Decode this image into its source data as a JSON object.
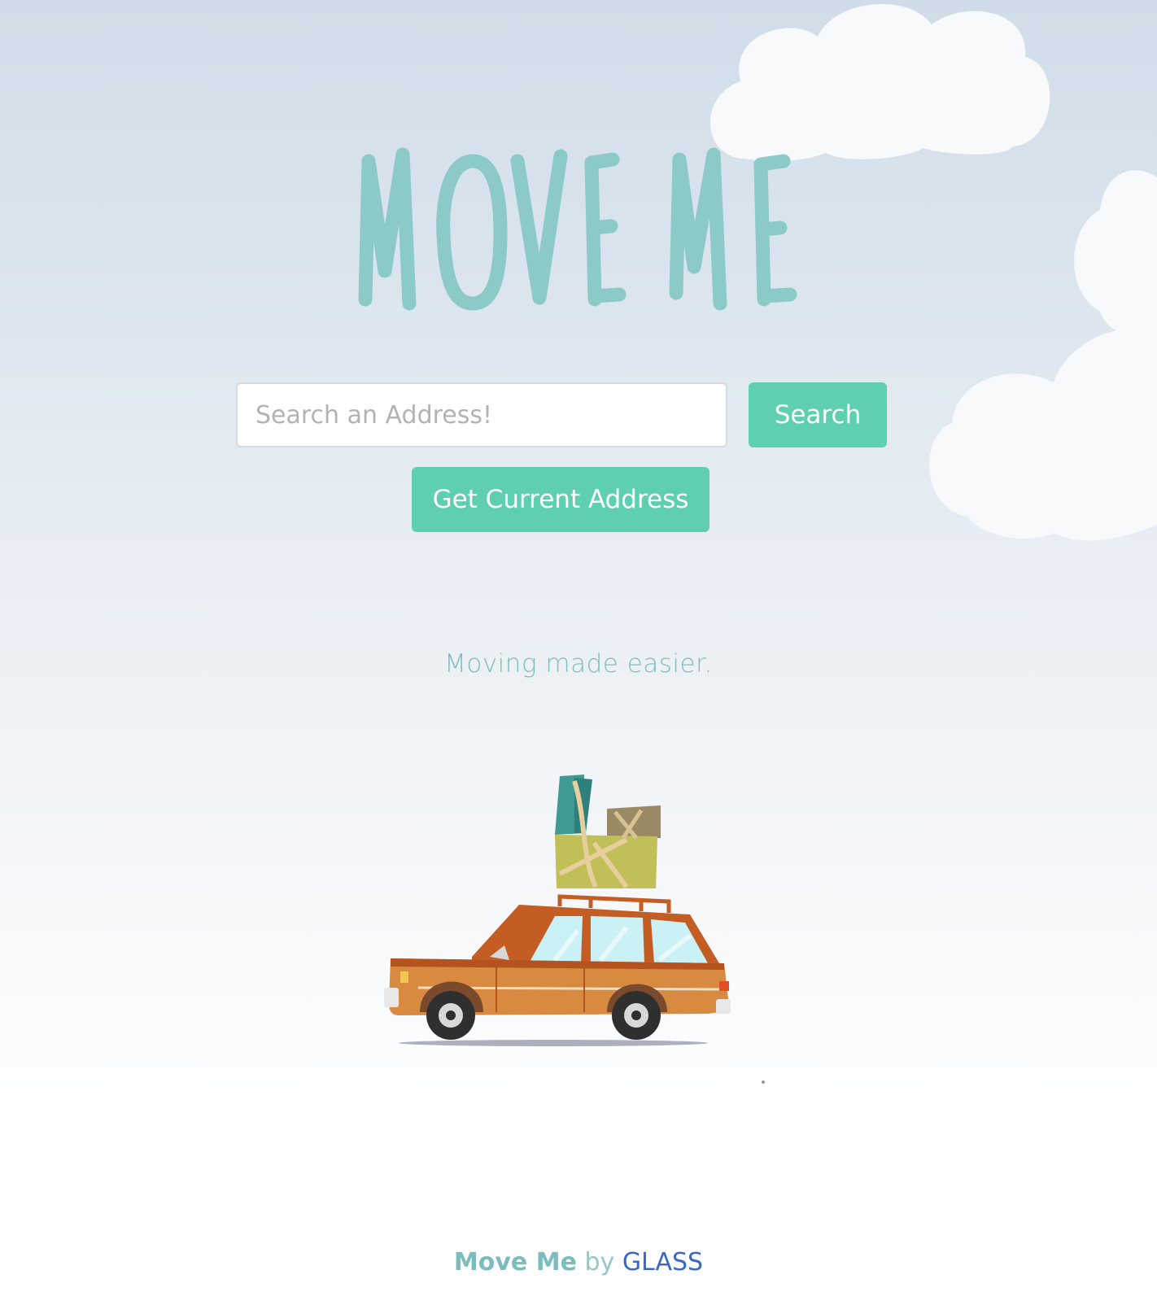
{
  "header": {
    "title": "MOVE ME"
  },
  "search": {
    "placeholder": "Search an Address!",
    "value": "",
    "search_label": "Search",
    "current_address_label": "Get Current Address"
  },
  "tagline": "Moving made easier.",
  "footer": {
    "brand": "Move Me",
    "by": "by",
    "org": "GLASS"
  },
  "colors": {
    "accent": "#5ecfb1",
    "title": "#8ccac8",
    "footer_link": "#3a68c8"
  },
  "icons": {
    "clouds": "cloud-icon",
    "illustration": "car-with-boxes-illustration"
  }
}
